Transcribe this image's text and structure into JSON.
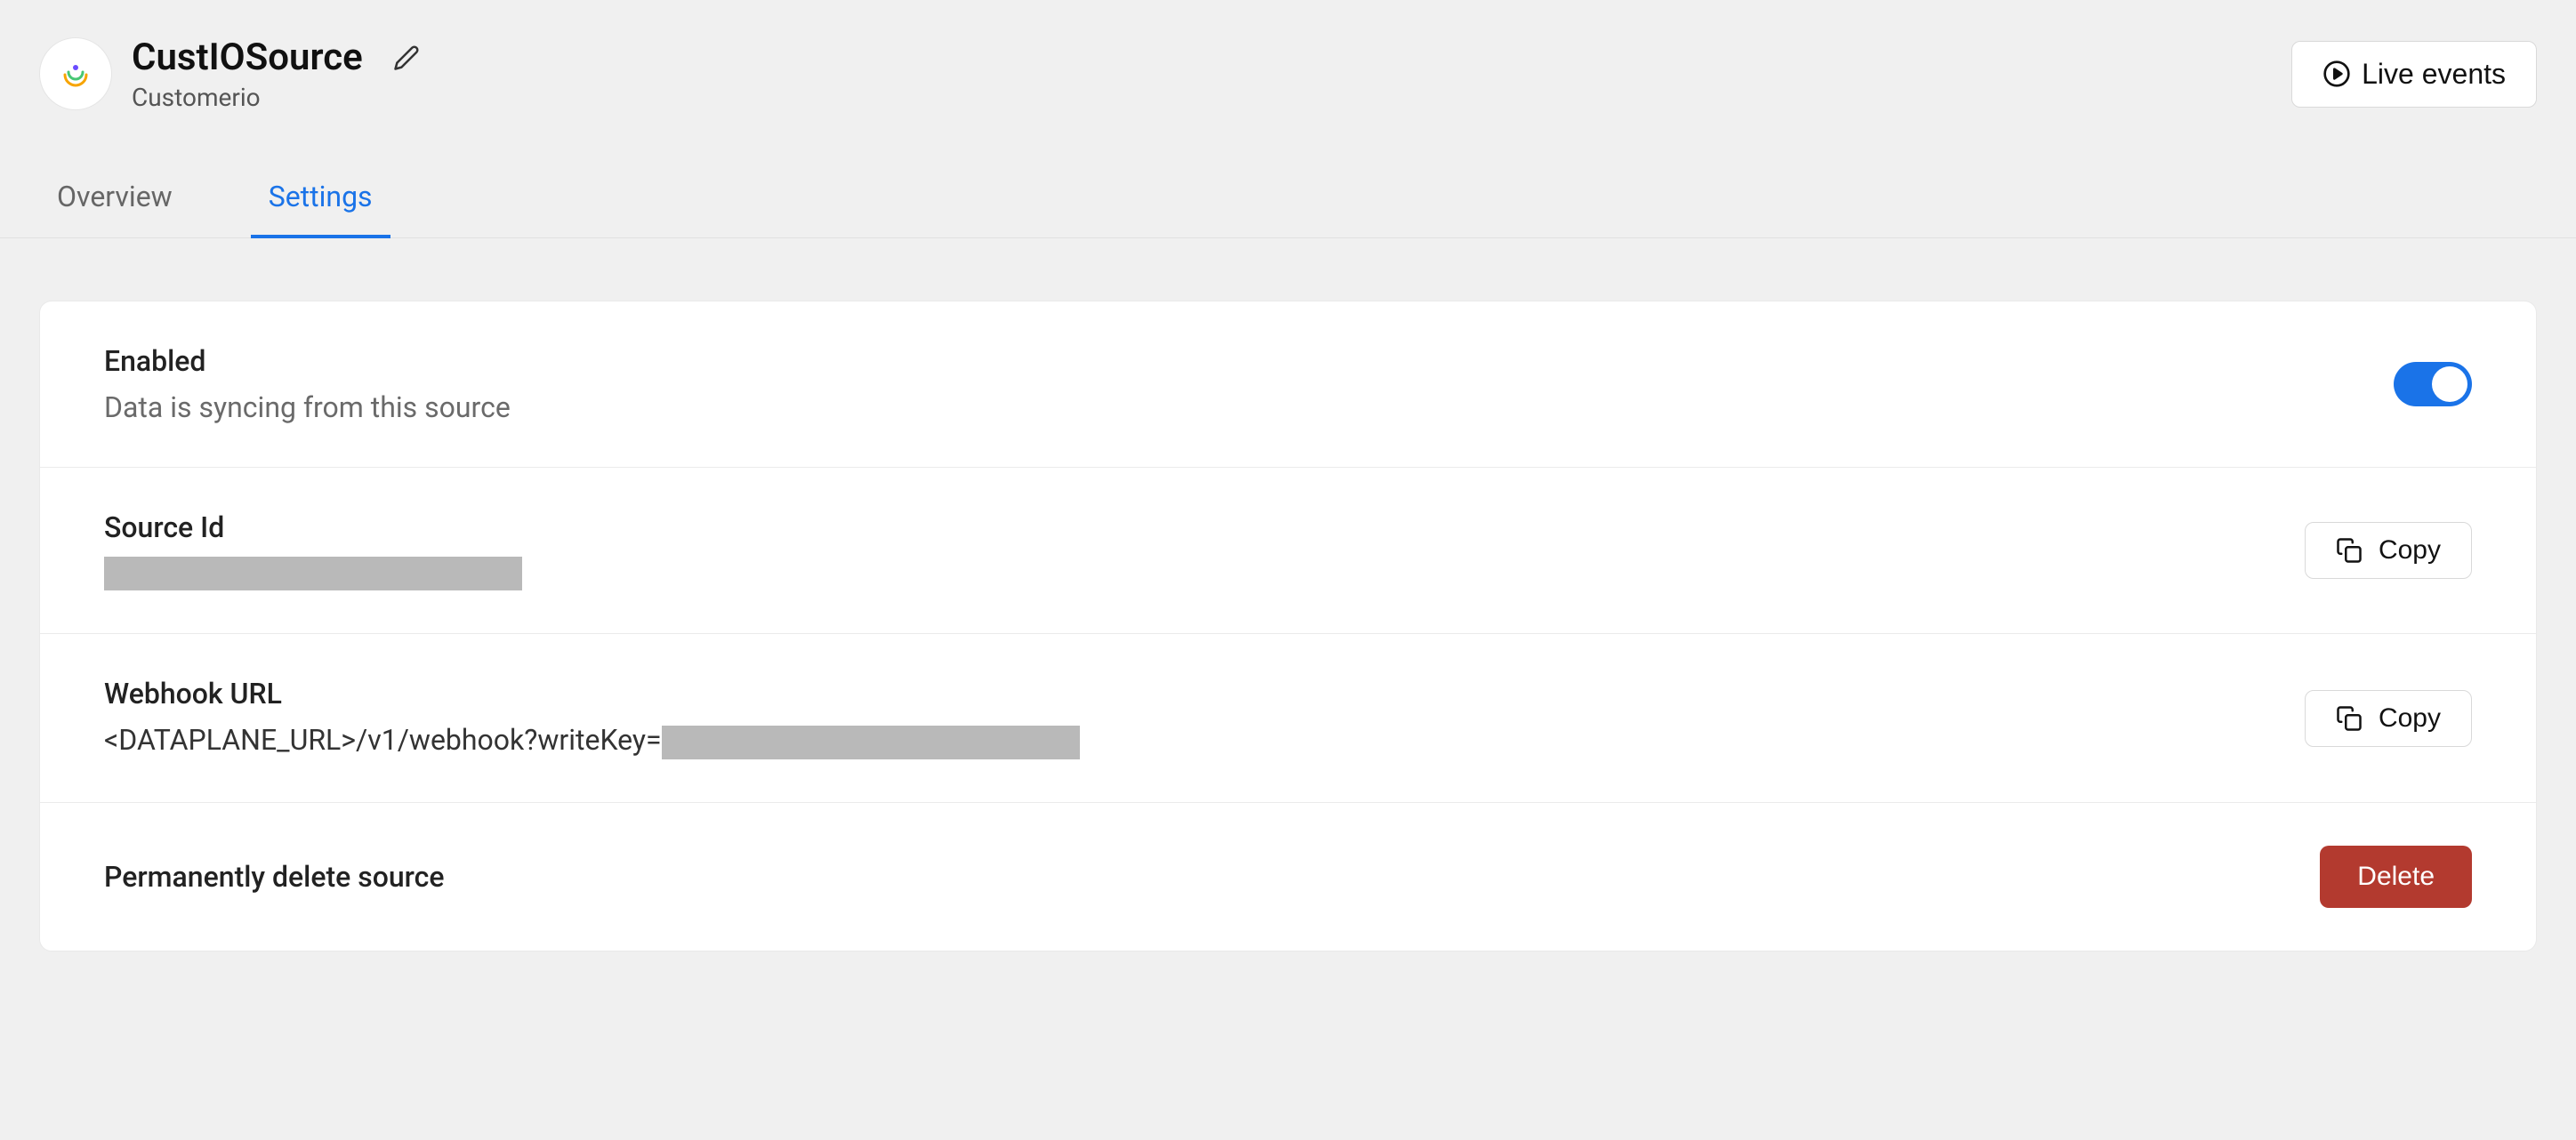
{
  "header": {
    "title": "CustIOSource",
    "subtitle": "Customerio",
    "live_events_label": "Live events"
  },
  "tabs": {
    "overview": "Overview",
    "settings": "Settings"
  },
  "rows": {
    "enabled": {
      "title": "Enabled",
      "desc": "Data is syncing from this source",
      "toggled": true
    },
    "source_id": {
      "title": "Source Id",
      "copy_label": "Copy"
    },
    "webhook": {
      "title": "Webhook URL",
      "prefix": "<DATAPLANE_URL>/v1/webhook?writeKey=",
      "copy_label": "Copy"
    },
    "delete": {
      "title": "Permanently delete source",
      "button_label": "Delete"
    }
  }
}
